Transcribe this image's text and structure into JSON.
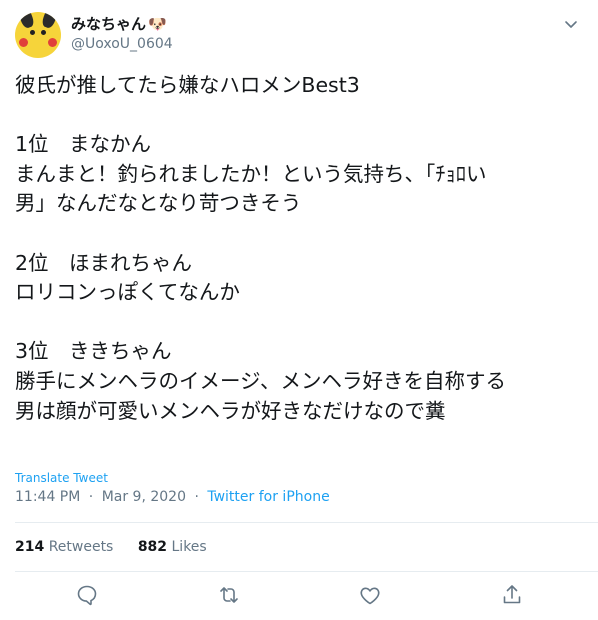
{
  "author": {
    "display_name": "みなちゃん",
    "emoji": "🐶",
    "handle": "@UoxoU_0604",
    "avatar_icon": "pikachu-avatar"
  },
  "tweet": {
    "text": "彼氏が推してたら嫌なハロメンBest3\n\n1位　まなかん\nまんまと！釣られましたか！という気持ち、「ﾁｮﾛい\n男」なんだなとなり苛つきそう\n\n2位　ほまれちゃん\nロリコンっぽくてなんか\n\n3位　ききちゃん\n勝手にメンヘラのイメージ、メンヘラ好きを自称する\n男は顔が可愛いメンヘラが好きなだけなので糞",
    "translate_label": "Translate Tweet",
    "time": "11:44 PM",
    "date": "Mar 9, 2020",
    "source": "Twitter for iPhone",
    "separator": "·"
  },
  "stats": {
    "retweets_count": "214",
    "retweets_label": "Retweets",
    "likes_count": "882",
    "likes_label": "Likes"
  },
  "actions": [
    "reply-icon",
    "retweet-icon",
    "like-icon",
    "share-icon"
  ],
  "colors": {
    "link": "#1da1f2",
    "muted": "#657786",
    "text": "#14171a",
    "divider": "#e6ecf0"
  }
}
